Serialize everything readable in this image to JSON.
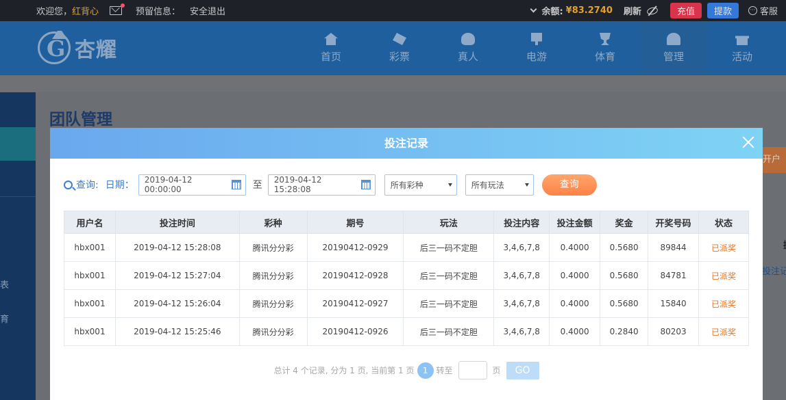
{
  "topbar": {
    "welcome": "欢迎您，",
    "username": "红背心",
    "reserve_label": "预留信息：",
    "logout": "安全退出",
    "balance_label": "余额:",
    "balance_value": "¥83.2740",
    "refresh": "刷新",
    "recharge": "充值",
    "withdraw": "提款",
    "service": "客服"
  },
  "header": {
    "logo_text": "杏耀",
    "nav": [
      {
        "label": "首页",
        "icon": "home-icon"
      },
      {
        "label": "彩票",
        "icon": "lottery-icon"
      },
      {
        "label": "真人",
        "icon": "live-dealer-icon"
      },
      {
        "label": "电游",
        "icon": "slot-game-icon"
      },
      {
        "label": "体育",
        "icon": "trophy-icon"
      },
      {
        "label": "管理",
        "icon": "users-icon"
      },
      {
        "label": "活动",
        "icon": "gift-icon"
      }
    ]
  },
  "background": {
    "page_title": "团队管理",
    "side_text_1": "表",
    "side_text_2": "育",
    "right_btn": "开户",
    "right_text_1": "握",
    "right_text_2": "投注记录"
  },
  "modal": {
    "title": "投注记录",
    "query_label": "查询:",
    "date_label": "日期：",
    "date_from": "2019-04-12 00:00:00",
    "to_label": "至",
    "date_to": "2019-04-12 15:28:08",
    "lottery_select": "所有彩种",
    "play_select": "所有玩法",
    "query_button": "查询"
  },
  "table": {
    "headers": [
      "用户名",
      "投注时间",
      "彩种",
      "期号",
      "玩法",
      "投注内容",
      "投注金额",
      "奖金",
      "开奖号码",
      "状态"
    ],
    "rows": [
      [
        "hbx001",
        "2019-04-12 15:28:08",
        "腾讯分分彩",
        "20190412-0929",
        "后三一码不定胆",
        "3,4,6,7,8",
        "0.4000",
        "0.5680",
        "89844",
        "已派奖"
      ],
      [
        "hbx001",
        "2019-04-12 15:27:04",
        "腾讯分分彩",
        "20190412-0928",
        "后三一码不定胆",
        "3,4,6,7,8",
        "0.4000",
        "0.5680",
        "84781",
        "已派奖"
      ],
      [
        "hbx001",
        "2019-04-12 15:26:04",
        "腾讯分分彩",
        "20190412-0927",
        "后三一码不定胆",
        "3,4,6,7,8",
        "0.4000",
        "0.5680",
        "15840",
        "已派奖"
      ],
      [
        "hbx001",
        "2019-04-12 15:25:46",
        "腾讯分分彩",
        "20190412-0926",
        "后三一码不定胆",
        "3,4,6,7,8",
        "0.4000",
        "0.2840",
        "80203",
        "已派奖"
      ]
    ]
  },
  "pager": {
    "summary": "总计 4 个记录, 分为 1 页, 当前第 1 页",
    "current_page": "1",
    "jump_label": "转至",
    "page_unit": "页",
    "go": "GO"
  }
}
